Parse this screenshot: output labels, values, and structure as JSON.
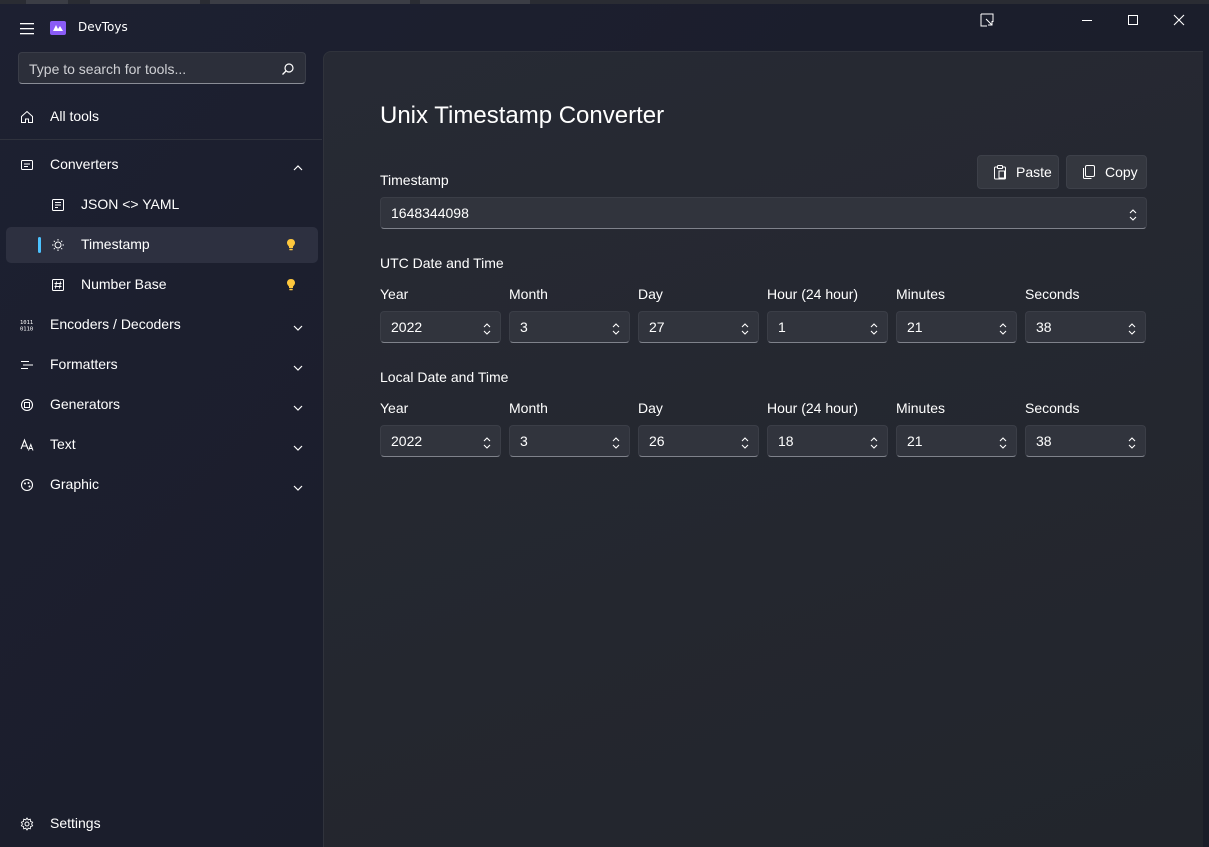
{
  "app": {
    "title": "DevToys"
  },
  "search": {
    "placeholder": "Type to search for tools..."
  },
  "sidebar": {
    "all_tools": "All tools",
    "converters": "Converters",
    "converter_items": [
      {
        "label": "JSON <> YAML"
      },
      {
        "label": "Timestamp"
      },
      {
        "label": "Number Base"
      }
    ],
    "groups": [
      {
        "label": "Encoders / Decoders"
      },
      {
        "label": "Formatters"
      },
      {
        "label": "Generators"
      },
      {
        "label": "Text"
      },
      {
        "label": "Graphic"
      }
    ],
    "settings": "Settings"
  },
  "page": {
    "title": "Unix Timestamp Converter",
    "paste_label": "Paste",
    "copy_label": "Copy",
    "timestamp_label": "Timestamp",
    "timestamp_value": "1648344098",
    "utc": {
      "heading": "UTC Date and Time",
      "fields": [
        {
          "label": "Year",
          "value": "2022"
        },
        {
          "label": "Month",
          "value": "3"
        },
        {
          "label": "Day",
          "value": "27"
        },
        {
          "label": "Hour (24 hour)",
          "value": "1"
        },
        {
          "label": "Minutes",
          "value": "21"
        },
        {
          "label": "Seconds",
          "value": "38"
        }
      ]
    },
    "local": {
      "heading": "Local Date and Time",
      "fields": [
        {
          "label": "Year",
          "value": "2022"
        },
        {
          "label": "Month",
          "value": "3"
        },
        {
          "label": "Day",
          "value": "26"
        },
        {
          "label": "Hour (24 hour)",
          "value": "18"
        },
        {
          "label": "Minutes",
          "value": "21"
        },
        {
          "label": "Seconds",
          "value": "38"
        }
      ]
    }
  },
  "colors": {
    "accent": "#4cc2ff",
    "bulb": "#ffc83d",
    "logo": "#8a5cf6"
  }
}
